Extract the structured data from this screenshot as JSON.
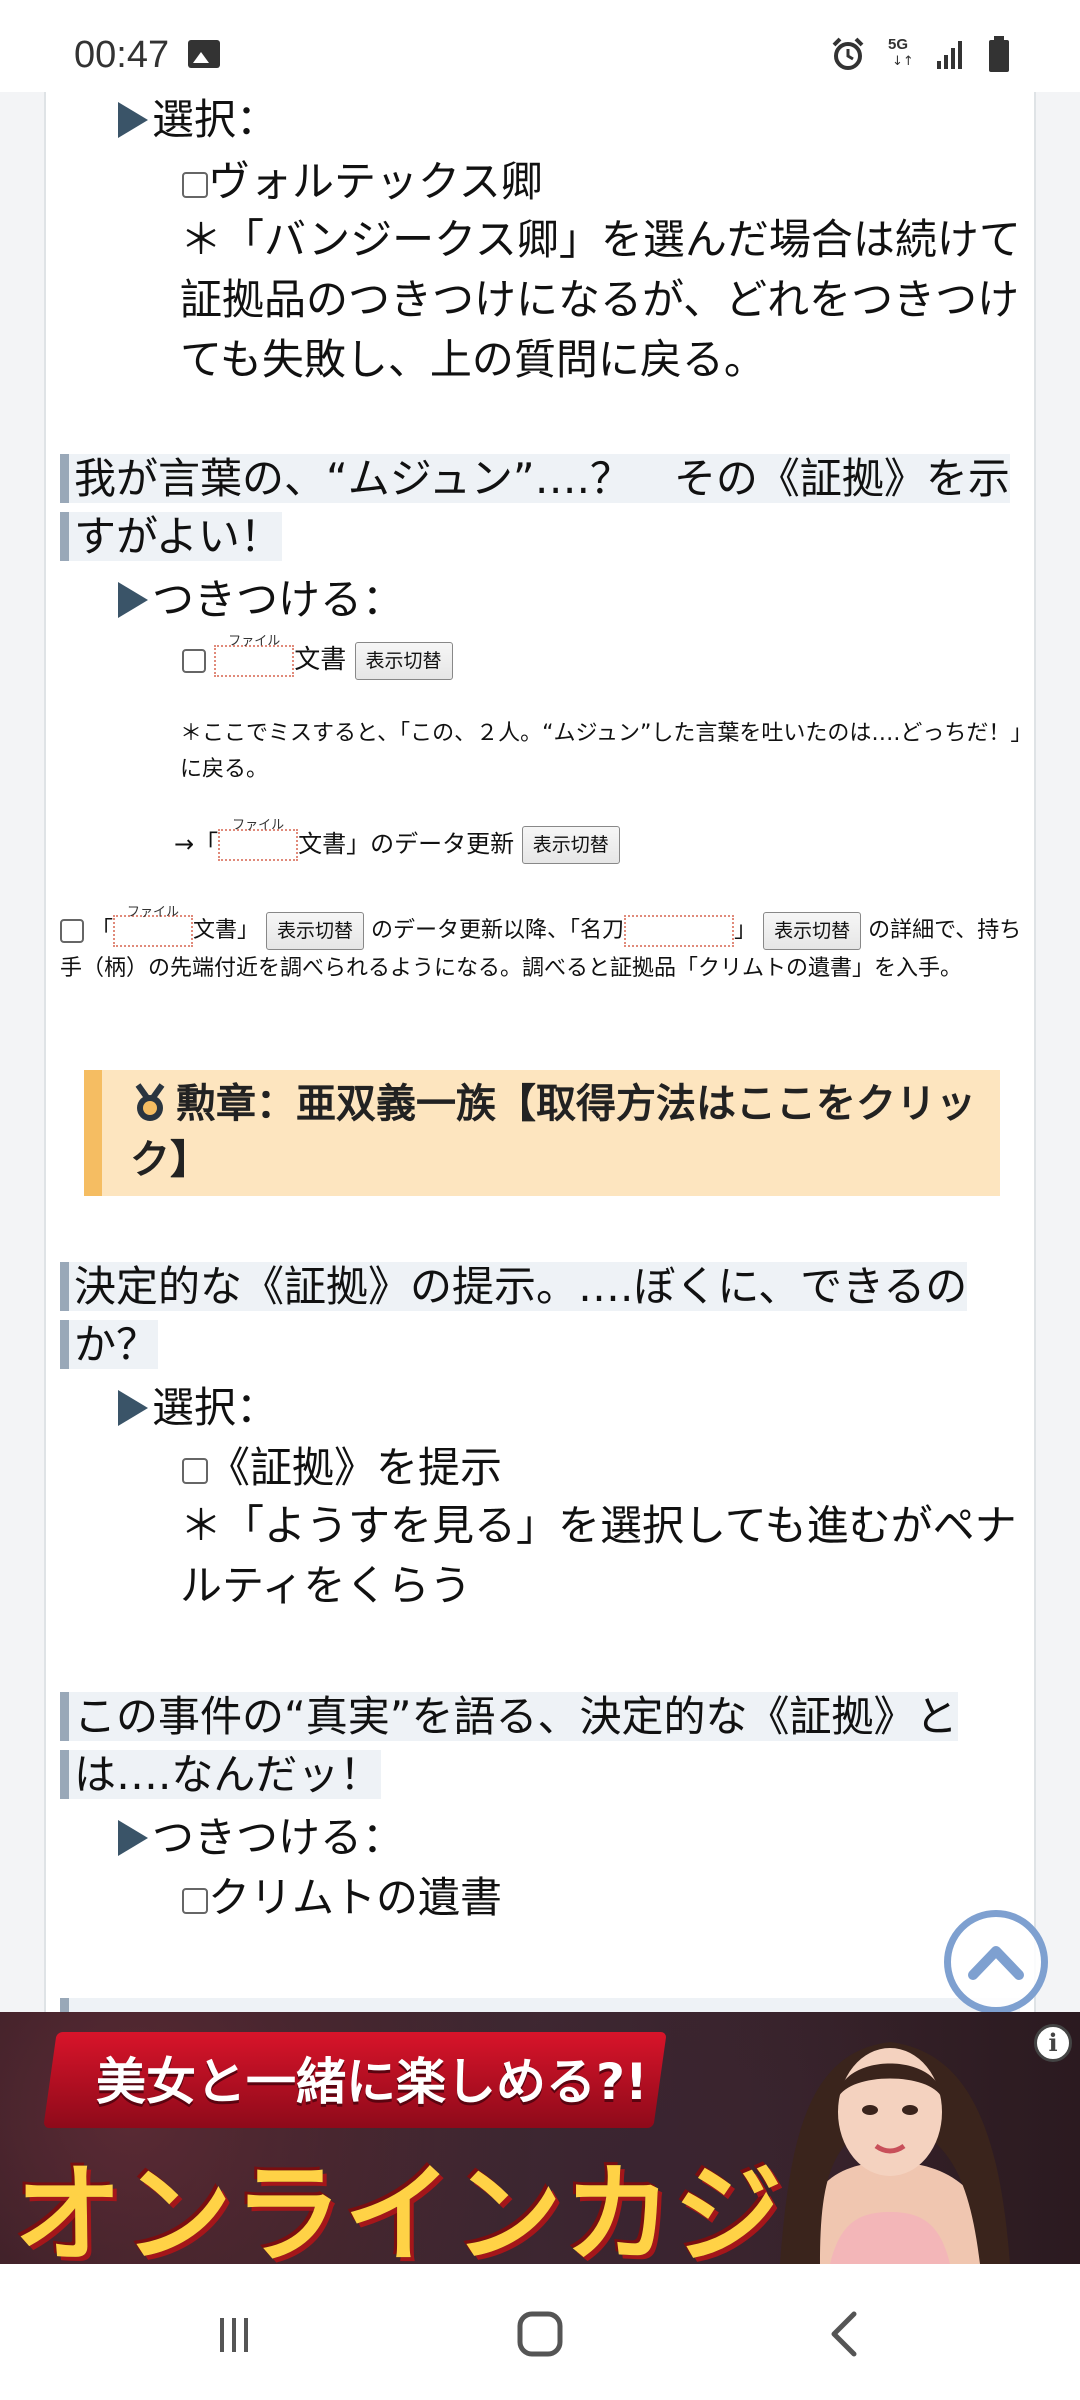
{
  "status_bar": {
    "time": "00:47",
    "network": "5G",
    "icons": [
      "image-icon",
      "alarm-icon",
      "5g-icon",
      "signal-icon",
      "battery-icon"
    ]
  },
  "content": {
    "s1_prefix": "選択：",
    "s1_option": "ヴォルテックス卿",
    "s1_note": "＊「バンジークス卿」を選んだ場合は続けて証拠品のつきつけになるが、どれをつきつけても失敗し、上の質問に戻る。",
    "h1": "我が言葉の、“ムジュン”….？　その《証拠》を示すがよい！",
    "s2_prefix": "つきつける：",
    "s2_ruby": "ファイル",
    "s2_tail": "文書",
    "toggle_label": "表示切替",
    "s2_note": "＊ここでミスすると、「この、２人。“ムジュン”した言葉を吐いたのは….どっちだ！」に戻る。",
    "s2_update_pre": "→「",
    "s2_update_ruby": "ファイル",
    "s2_update_mid": "文書」のデータ更新",
    "p_open": "「",
    "p_ruby1": "ファイル",
    "p_text1": "文書」",
    "p_text2": "のデータ更新以降、「名刀",
    "p_text3": "」",
    "p_text4": "の詳細で、持ち手（柄）の先端付近を調べられるようになる。調べると証拠品「クリムトの遺書」を入手。",
    "medal_text": "勲章：亜双義一族【取得方法はここをクリック】",
    "h2": "決定的な《証拠》の提示。….ぼくに、できるのか？",
    "s3_prefix": "選択：",
    "s3_option": "《証拠》を提示",
    "s3_note": "＊「ようすを見る」を選択しても進むがペナルティをくらう",
    "h3": "この事件の“真実”を語る、決定的な《証拠》とは….なんだッ！",
    "s4_prefix": "つきつける：",
    "s4_option": "クリムトの遺書"
  },
  "ad": {
    "tagline": "美女と一緒に楽しめる?!",
    "title": "オンラインカジノ",
    "info": "i"
  },
  "nav": {
    "icons": [
      "recent-apps-icon",
      "home-icon",
      "back-icon"
    ]
  },
  "colors": {
    "heading_bar": "#99a8b8",
    "heading_bg": "#eef2f6",
    "medal_bg": "#fde5bf",
    "medal_bar": "#f5bd62",
    "arrow": "#3a5468",
    "scroll_button": "#7ea0d0"
  }
}
